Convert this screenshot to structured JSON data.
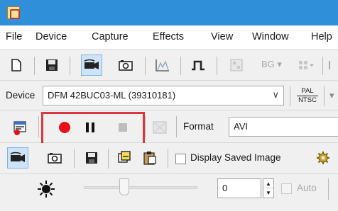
{
  "window": {
    "app_icon": "ic-capture-app-icon"
  },
  "menu": [
    "File",
    "Device",
    "Capture",
    "Effects",
    "View",
    "Window",
    "Help"
  ],
  "toolbar1": {
    "bg_label": "BG ▾"
  },
  "device_bar": {
    "label": "Device",
    "selected_device": "DFM 42BUC03-ML (39310181)",
    "dropdown_arrow": "∨",
    "video_norm_top": "PAL",
    "video_norm_bottom": "NTSC"
  },
  "record_bar": {
    "format_label": "Format",
    "format_value": "AVI"
  },
  "image_bar": {
    "display_saved_label": "Display Saved Image"
  },
  "property_bar": {
    "value": "0",
    "auto_label": "Auto"
  },
  "colors": {
    "accent_record": "#e8101a",
    "highlight": "#d9363e",
    "titlebar": "#2f8fd8"
  }
}
